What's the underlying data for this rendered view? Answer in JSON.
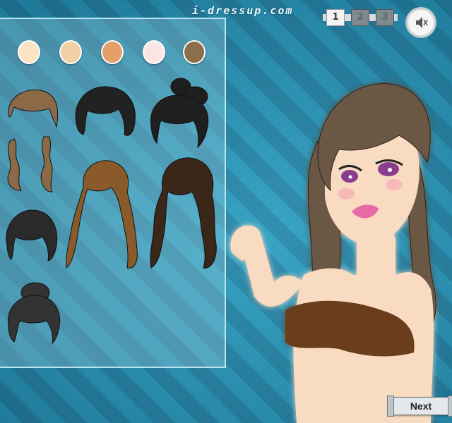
{
  "header": {
    "site_logo": "i-dressup.com"
  },
  "pagination": {
    "pages": [
      "1",
      "2",
      "3"
    ],
    "active_page": "1"
  },
  "sound": {
    "icon": "speaker-muted-icon"
  },
  "skin_tones": [
    {
      "name": "skin-tone-1",
      "color": "#fbe3c4"
    },
    {
      "name": "skin-tone-2",
      "color": "#f2cfa5"
    },
    {
      "name": "skin-tone-3",
      "color": "#e5a06a"
    },
    {
      "name": "skin-tone-4",
      "color": "#fbe4e4"
    },
    {
      "name": "skin-tone-5",
      "color": "#8c6e4c"
    }
  ],
  "hairstyles": [
    {
      "name": "hair-option-1",
      "color": "#8c6a47"
    },
    {
      "name": "hair-option-2",
      "color": "#222222"
    },
    {
      "name": "hair-option-3",
      "color": "#1f1f1f"
    },
    {
      "name": "hair-option-4",
      "color": "#8a5a2b"
    },
    {
      "name": "hair-option-5",
      "color": "#3b261a"
    },
    {
      "name": "hair-option-6",
      "color": "#2a2a2a"
    },
    {
      "name": "hair-option-7",
      "color": "#333333"
    }
  ],
  "model": {
    "hair_color": "#6b5844",
    "skin_color": "#f9dbc2",
    "top_color": "#6b3d1c",
    "lip_color": "#e86aa6",
    "eye_color": "#8a3e8c"
  },
  "footer": {
    "next_label": "Next"
  }
}
